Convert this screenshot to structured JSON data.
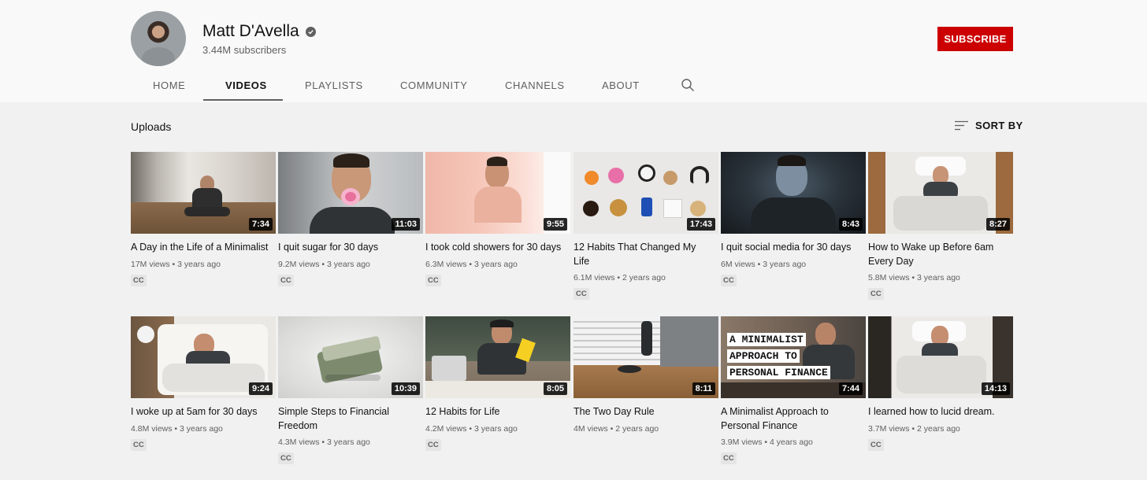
{
  "channel": {
    "name": "Matt D'Avella",
    "subscribers": "3.44M subscribers",
    "subscribe_label": "SUBSCRIBE"
  },
  "tabs": [
    {
      "label": "HOME"
    },
    {
      "label": "VIDEOS",
      "active": true
    },
    {
      "label": "PLAYLISTS"
    },
    {
      "label": "COMMUNITY"
    },
    {
      "label": "CHANNELS"
    },
    {
      "label": "ABOUT"
    }
  ],
  "section": {
    "title": "Uploads",
    "sort_label": "SORT BY"
  },
  "videos": [
    {
      "title": "A Day in the Life of a Minimalist",
      "views": "17M views",
      "age": "3 years ago",
      "duration": "7:34",
      "badge": "CC"
    },
    {
      "title": "I quit sugar for 30 days",
      "views": "9.2M views",
      "age": "3 years ago",
      "duration": "11:03",
      "badge": "CC"
    },
    {
      "title": "I took cold showers for 30 days",
      "views": "6.3M views",
      "age": "3 years ago",
      "duration": "9:55",
      "badge": "CC"
    },
    {
      "title": "12 Habits That Changed My Life",
      "views": "6.1M views",
      "age": "2 years ago",
      "duration": "17:43",
      "badge": "CC"
    },
    {
      "title": "I quit social media for 30 days",
      "views": "6M views",
      "age": "3 years ago",
      "duration": "8:43",
      "badge": "CC"
    },
    {
      "title": "How to Wake up Before 6am Every Day",
      "views": "5.8M views",
      "age": "3 years ago",
      "duration": "8:27",
      "badge": "CC"
    },
    {
      "title": "I woke up at 5am for 30 days",
      "views": "4.8M views",
      "age": "3 years ago",
      "duration": "9:24",
      "badge": "CC"
    },
    {
      "title": "Simple Steps to Financial Freedom",
      "views": "4.3M views",
      "age": "3 years ago",
      "duration": "10:39",
      "badge": "CC"
    },
    {
      "title": "12 Habits for Life",
      "views": "4.2M views",
      "age": "3 years ago",
      "duration": "8:05",
      "badge": "CC"
    },
    {
      "title": "The Two Day Rule",
      "views": "4M views",
      "age": "2 years ago",
      "duration": "8:11",
      "badge": ""
    },
    {
      "title": "A Minimalist Approach to Personal Finance",
      "views": "3.9M views",
      "age": "4 years ago",
      "duration": "7:44",
      "badge": "CC",
      "overlay": [
        "A MINIMALIST",
        "APPROACH TO",
        "PERSONAL FINANCE"
      ]
    },
    {
      "title": "I learned how to lucid dream.",
      "views": "3.7M views",
      "age": "2 years ago",
      "duration": "14:13",
      "badge": "CC"
    }
  ],
  "colors": {
    "subscribe": "#cc0000",
    "header_bg": "#f9f9f9",
    "page_bg": "#f1f1f1"
  },
  "icons": [
    "verified-icon",
    "search-icon",
    "sort-icon"
  ]
}
